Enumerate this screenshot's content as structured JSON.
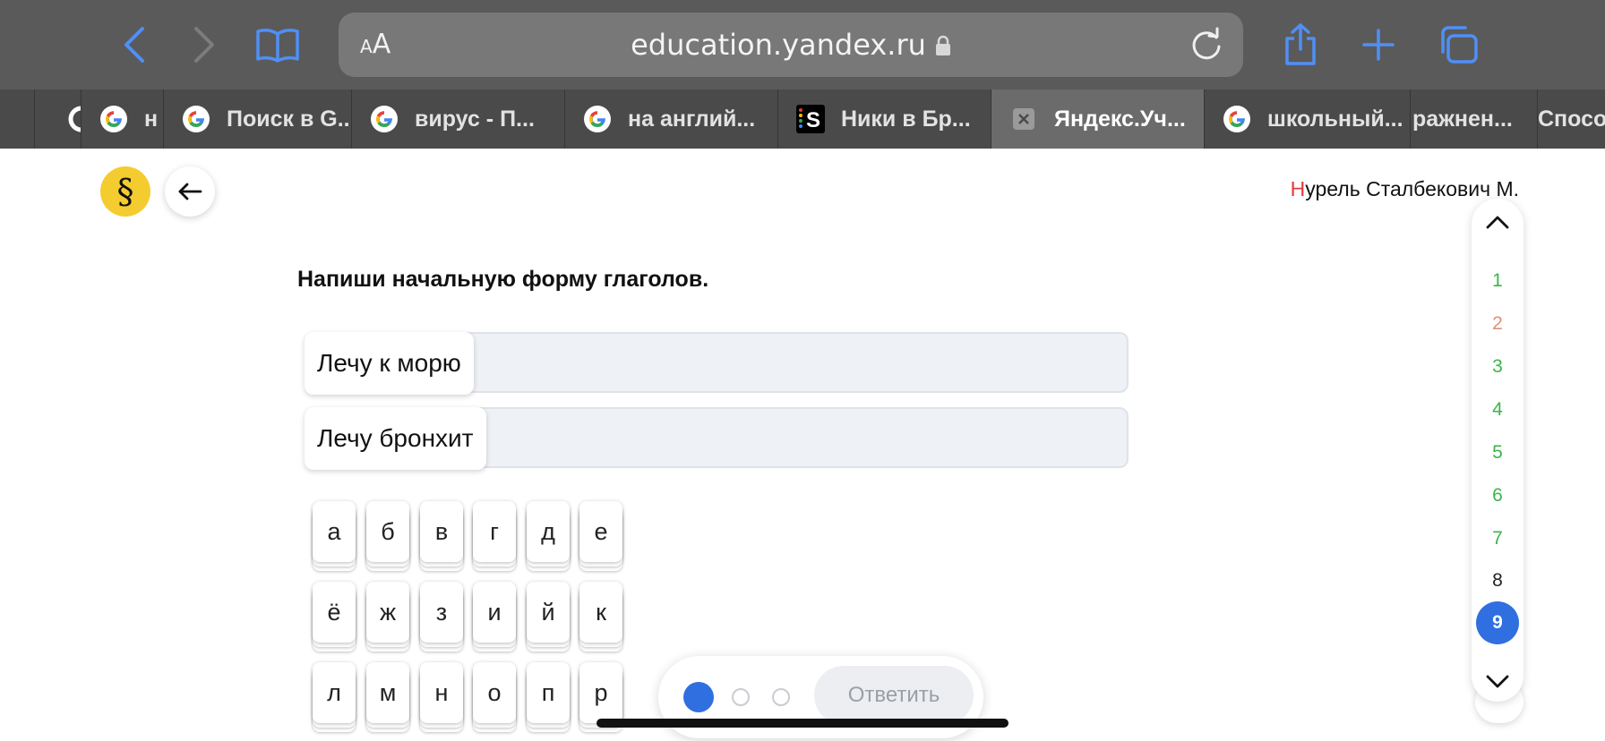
{
  "browser": {
    "address_text_small": "A",
    "address_text_large": "A",
    "url": "education.yandex.ru",
    "tabs": [
      {
        "title": "",
        "icon": "google-icon"
      },
      {
        "title": "н",
        "icon": "google-icon"
      },
      {
        "title": "Поиск в G...",
        "icon": "google-icon"
      },
      {
        "title": "вирус - П...",
        "icon": "google-icon"
      },
      {
        "title": "на англий...",
        "icon": "google-icon"
      },
      {
        "title": "Ники в Бр...",
        "icon": "s-icon"
      },
      {
        "title": "Яндекс.Уч...",
        "icon": "close-icon",
        "active": true
      },
      {
        "title": "школьный...",
        "icon": "google-icon"
      },
      {
        "title": "ражнен...",
        "icon": ""
      },
      {
        "title": "Способ",
        "icon": ""
      }
    ]
  },
  "header": {
    "logo_symbol": "§",
    "user_first_letter": "Н",
    "user_rest": "урель Сталбекович М."
  },
  "task": {
    "title": "Напиши начальную форму глаголов.",
    "rows": [
      {
        "label": "Лечу к морю",
        "value": ""
      },
      {
        "label": "Лечу бронхит",
        "value": ""
      }
    ]
  },
  "keyboard": {
    "rows": [
      [
        "а",
        "б",
        "в",
        "г",
        "д",
        "е"
      ],
      [
        "ё",
        "ж",
        "з",
        "и",
        "й",
        "к"
      ],
      [
        "л",
        "м",
        "н",
        "о",
        "п",
        "р"
      ]
    ]
  },
  "question_nav": {
    "items": [
      {
        "label": "1",
        "status": "correct"
      },
      {
        "label": "2",
        "status": "wrong"
      },
      {
        "label": "3",
        "status": "correct"
      },
      {
        "label": "4",
        "status": "correct"
      },
      {
        "label": "5",
        "status": "correct"
      },
      {
        "label": "6",
        "status": "correct"
      },
      {
        "label": "7",
        "status": "correct"
      },
      {
        "label": "8",
        "status": "pending"
      },
      {
        "label": "9",
        "status": "current"
      }
    ]
  },
  "bottom": {
    "submit_label": "Ответить",
    "progress_dots": [
      true,
      false,
      false
    ]
  },
  "colors": {
    "accent": "#2f6fe0",
    "correct": "#3bb54a",
    "wrong": "#e0907a",
    "logo": "#f5cc2f",
    "safari_icon": "#4f8ff7"
  }
}
